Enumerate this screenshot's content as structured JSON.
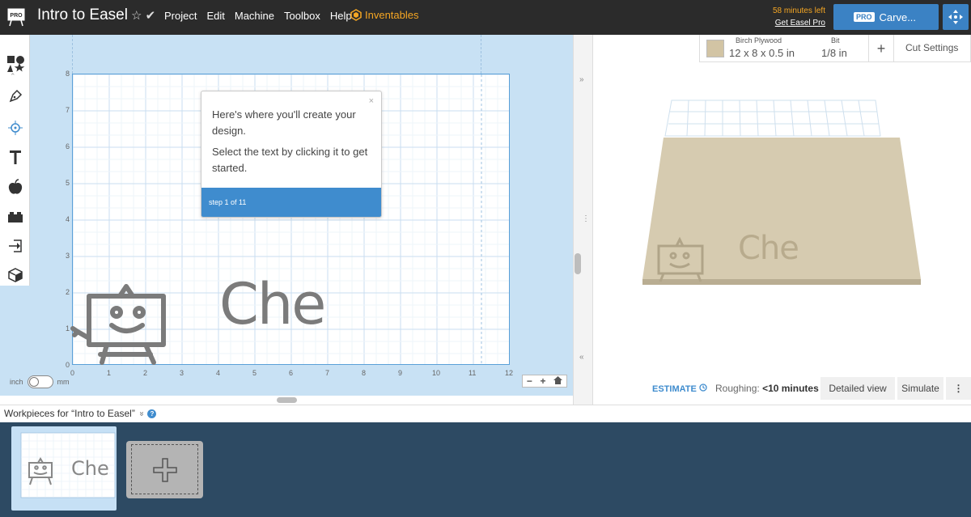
{
  "app": {
    "title": "Intro to Easel",
    "menu": [
      "Project",
      "Edit",
      "Machine",
      "Toolbox",
      "Help"
    ],
    "inventables": "Inventables",
    "pro_logo": "PRO",
    "time_left": "58 minutes left",
    "get_pro": "Get Easel Pro",
    "carve": {
      "badge": "PRO",
      "label": "Carve..."
    }
  },
  "canvas": {
    "x_ticks": [
      "0",
      "1",
      "2",
      "3",
      "4",
      "5",
      "6",
      "7",
      "8",
      "9",
      "10",
      "11",
      "12"
    ],
    "y_ticks": [
      "8",
      "7",
      "6",
      "5",
      "4",
      "3",
      "2",
      "1",
      "0"
    ],
    "text": "Che"
  },
  "tooltip": {
    "close": "×",
    "line1": "Here's where you'll create your design.",
    "line2": "Select the text by clicking it to get started.",
    "step": "step 1 of 11"
  },
  "units": {
    "inch": "inch",
    "mm": "mm"
  },
  "zoom": {
    "minus": "−",
    "plus": "+"
  },
  "material": {
    "name": "Birch Plywood",
    "dims": "12 x 8 x 0.5 in",
    "bit_label": "Bit",
    "bit_value": "1/8 in",
    "plus": "+",
    "cut_settings": "Cut Settings"
  },
  "preview": {
    "text": "Che"
  },
  "estimate": {
    "label": "ESTIMATE",
    "roughing_label": "Roughing:",
    "roughing_value": "<10 minutes",
    "detailed": "Detailed view",
    "simulate": "Simulate",
    "more": "⋮"
  },
  "workpieces": {
    "title": "Workpieces for “Intro to Easel”",
    "chevron": "»",
    "help": "?",
    "thumb_text": "Che"
  },
  "colors": {
    "topbar": "#2b2b2b",
    "accent": "#3f8cce",
    "canvas_bg": "#c8e1f4",
    "orange": "#f5a623",
    "wood": "#d2c4a4",
    "panel": "#2d4a63"
  }
}
